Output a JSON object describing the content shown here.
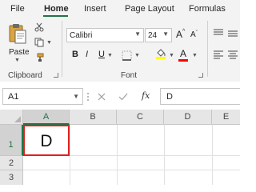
{
  "ribbon_tabs": [
    {
      "label": "File"
    },
    {
      "label": "Home",
      "active": true
    },
    {
      "label": "Insert"
    },
    {
      "label": "Page Layout"
    },
    {
      "label": "Formulas"
    }
  ],
  "clipboard": {
    "paste_label": "Paste",
    "group_label": "Clipboard"
  },
  "font": {
    "font_name": "Calibri",
    "font_size": "24",
    "grow_label": "A",
    "shrink_label": "A",
    "bold": "B",
    "italic": "I",
    "underline": "U",
    "font_color_label": "A",
    "group_label": "Font",
    "highlight_color": "#ffff00",
    "font_color": "#ff0000"
  },
  "formula_bar": {
    "name_box": "A1",
    "fx_label": "fx",
    "content": "D"
  },
  "columns": [
    "A",
    "B",
    "C",
    "D",
    "E"
  ],
  "rows": [
    "1",
    "2",
    "3"
  ],
  "active_cell": {
    "address": "A1",
    "value": "D",
    "border_color": "#e02020"
  },
  "colors": {
    "accent": "#217346",
    "ribbon_bg": "#f3f3f3"
  }
}
